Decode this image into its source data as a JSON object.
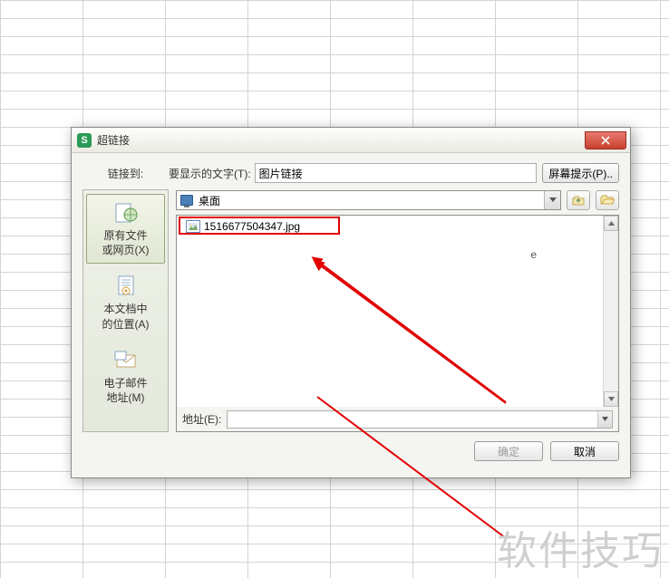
{
  "dialog": {
    "title": "超链接",
    "linkto_label": "链接到:",
    "display_text_label": "要显示的文字(T):",
    "display_text_value": "图片链接",
    "screen_tip_btn": "屏幕提示(P)..",
    "location_selected": "桌面",
    "address_label": "地址(E):",
    "address_value": "",
    "ok_btn": "确定",
    "cancel_btn": "取消"
  },
  "side": {
    "items": [
      {
        "label": "原有文件\n或网页(X)"
      },
      {
        "label": "本文档中\n的位置(A)"
      },
      {
        "label": "电子邮件\n地址(M)"
      }
    ]
  },
  "files": {
    "items": [
      {
        "name": "1516677504347.jpg"
      }
    ]
  },
  "stray": {
    "e": "e"
  },
  "watermark": "软件技巧"
}
